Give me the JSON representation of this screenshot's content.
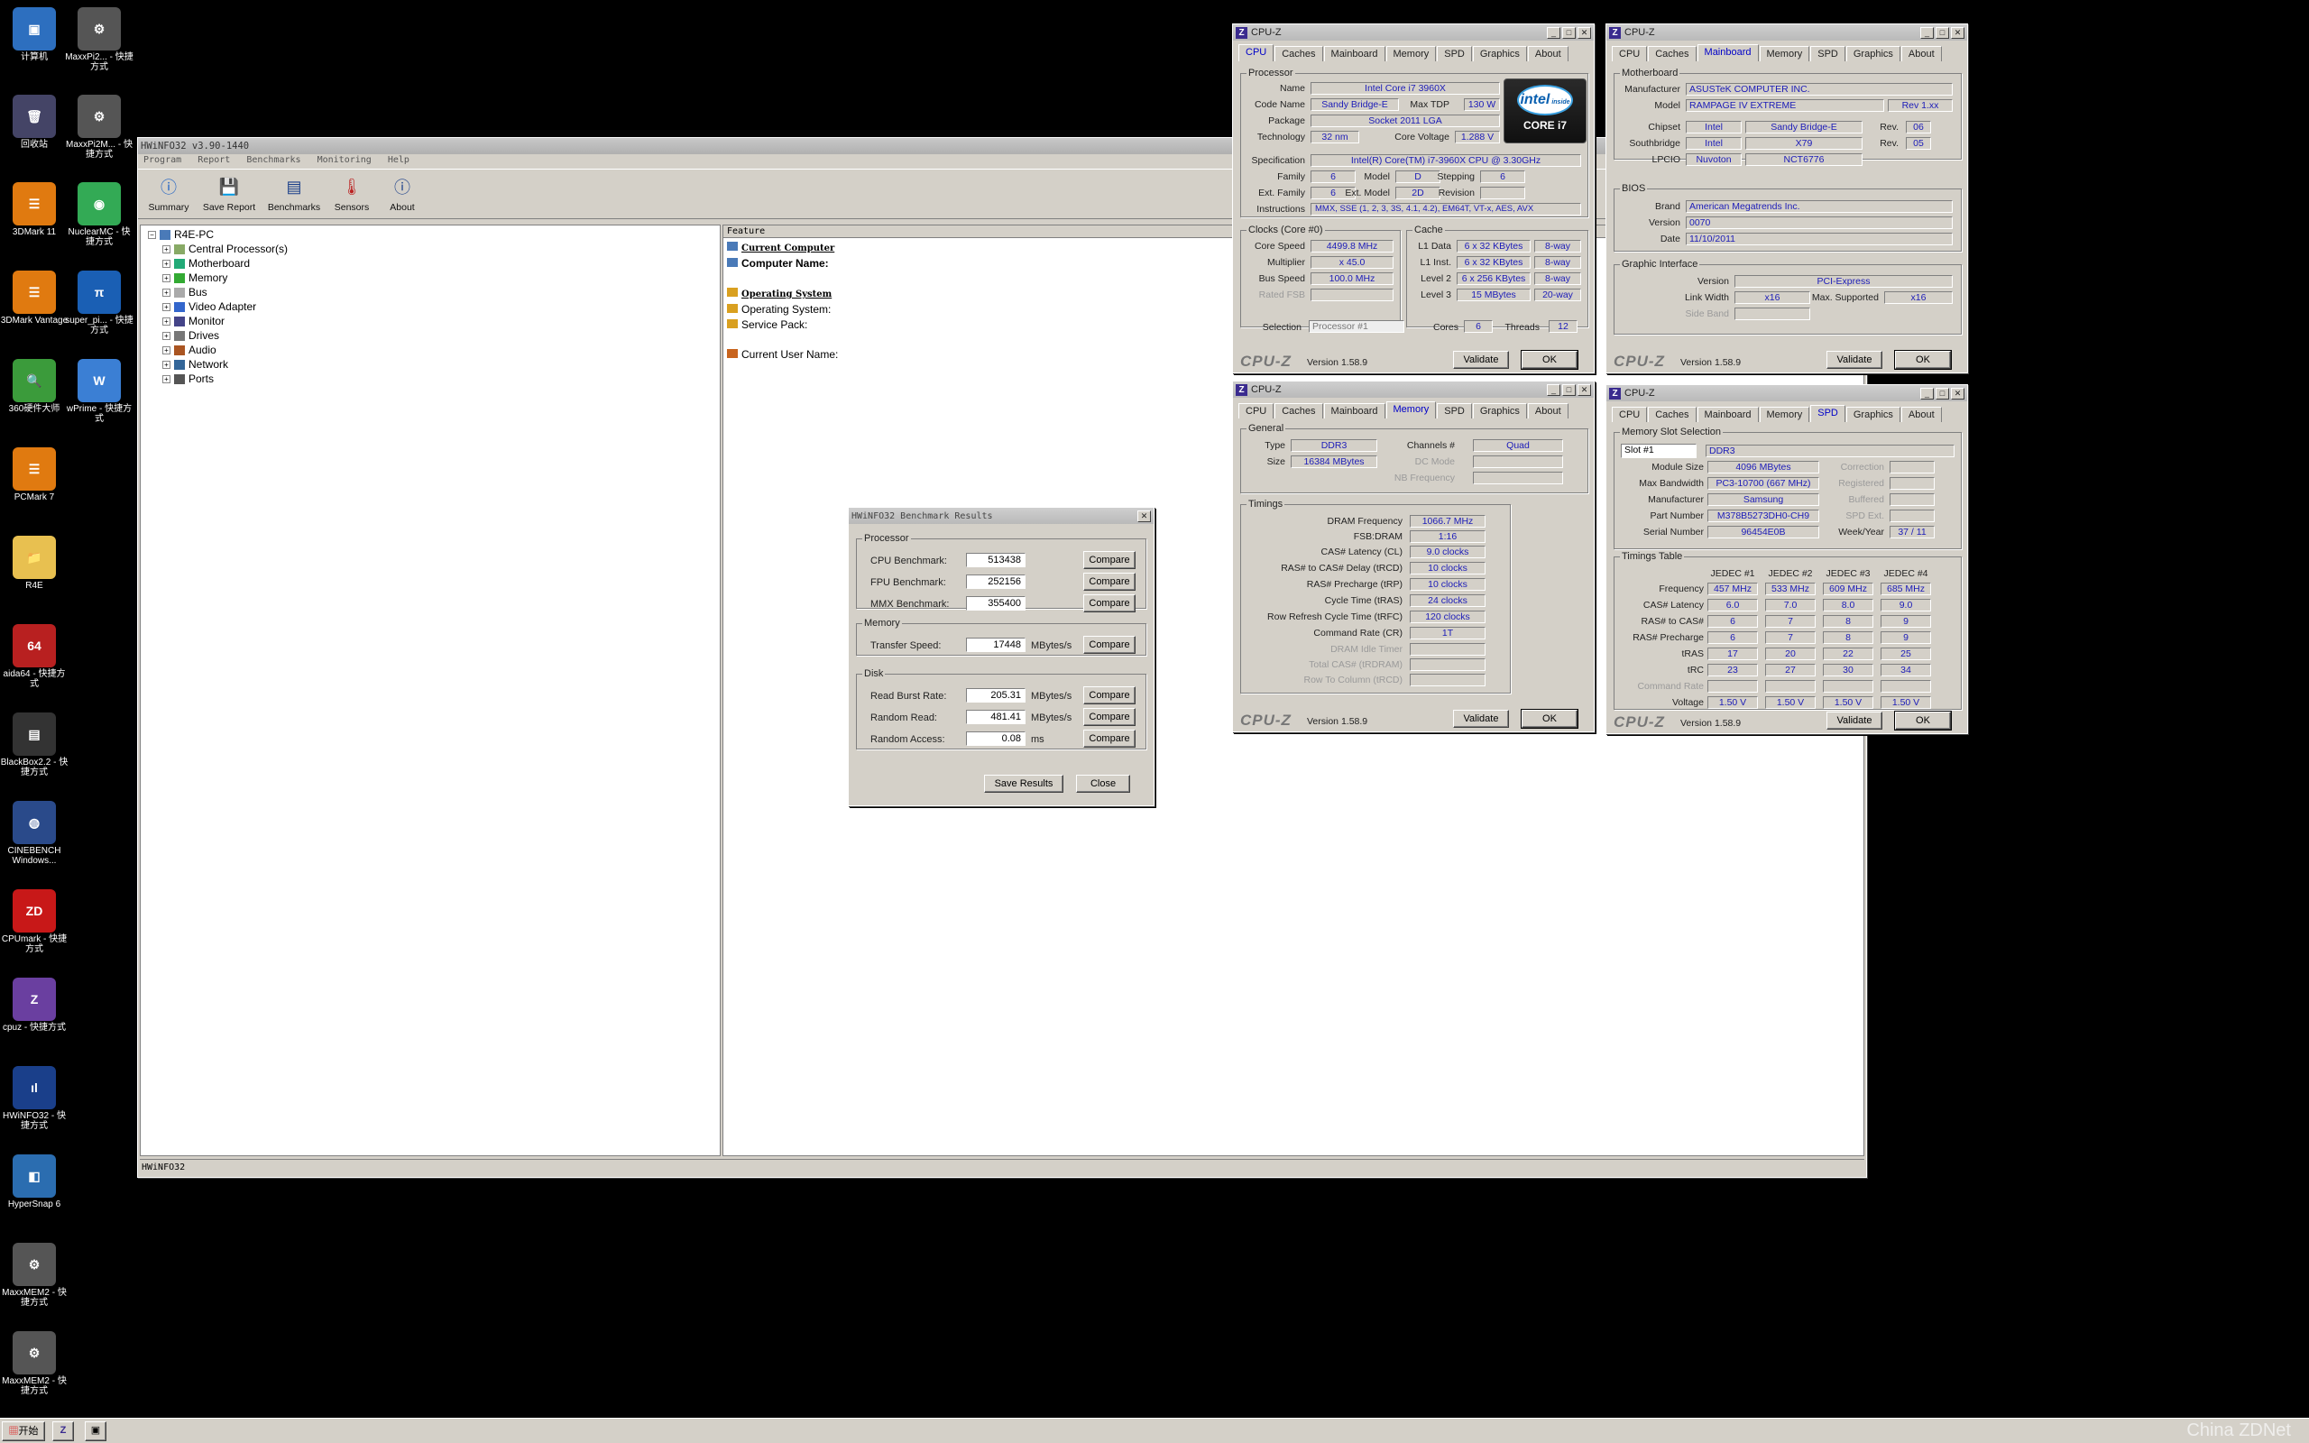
{
  "desktop": {
    "icons": [
      {
        "label": "计算机",
        "color": "#2d6fbf",
        "glyph": "▣"
      },
      {
        "label": "MaxxPi2... - 快捷方式",
        "color": "#555",
        "glyph": "⚙"
      },
      {
        "label": "回收站",
        "color": "#446",
        "glyph": "🗑"
      },
      {
        "label": "MaxxPi2M... - 快捷方式",
        "color": "#555",
        "glyph": "⚙"
      },
      {
        "label": "3DMark 11",
        "color": "#e07a10",
        "glyph": "☰"
      },
      {
        "label": "NuclearMC - 快捷方式",
        "color": "#3a5",
        "glyph": "◉"
      },
      {
        "label": "3DMark Vantage",
        "color": "#e07a10",
        "glyph": "☰"
      },
      {
        "label": "super_pi... - 快捷方式",
        "color": "#1a5fb4",
        "glyph": "π"
      },
      {
        "label": "360硬件大师",
        "color": "#3b9b3b",
        "glyph": "🔍"
      },
      {
        "label": "wPrime - 快捷方式",
        "color": "#3b7fd4",
        "glyph": "W"
      },
      {
        "label": "PCMark 7",
        "color": "#e07a10",
        "glyph": "☰"
      },
      {
        "label": "R4E",
        "color": "#e8c050",
        "glyph": "📁"
      },
      {
        "label": "aida64 - 快捷方式",
        "color": "#b82020",
        "glyph": "64"
      },
      {
        "label": "BlackBox2.2 - 快捷方式",
        "color": "#333",
        "glyph": "▤"
      },
      {
        "label": "CINEBENCH Windows...",
        "color": "#2a4a8a",
        "glyph": "◍"
      },
      {
        "label": "CPUmark - 快捷方式",
        "color": "#c81818",
        "glyph": "ZD"
      },
      {
        "label": "cpuz - 快捷方式",
        "color": "#6a3fa0",
        "glyph": "Z"
      },
      {
        "label": "HWiNFO32 - 快捷方式",
        "color": "#1a3f8a",
        "glyph": "ıl"
      },
      {
        "label": "HyperSnap 6",
        "color": "#2b6db0",
        "glyph": "◧"
      },
      {
        "label": "MaxxMEM2 - 快捷方式",
        "color": "#555",
        "glyph": "⚙"
      },
      {
        "label": "MaxxMEM2 - 快捷方式",
        "color": "#555",
        "glyph": "⚙"
      }
    ]
  },
  "hwinfo": {
    "title": "HWiNFO32 v3.90-1440",
    "menu": [
      "Program",
      "Report",
      "Benchmarks",
      "Monitoring",
      "Help"
    ],
    "toolbar": [
      "Summary",
      "Save Report",
      "Benchmarks",
      "Sensors",
      "About"
    ],
    "tree_root": "R4E-PC",
    "tree": [
      "Central Processor(s)",
      "Motherboard",
      "Memory",
      "Bus",
      "Video Adapter",
      "Monitor",
      "Drives",
      "Audio",
      "Network",
      "Ports"
    ],
    "feature_header": "Feature",
    "current_computer": "Current Computer",
    "computer_name": "Computer Name:",
    "operating_system_hdr": "Operating System",
    "operating_system": "Operating System:",
    "service_pack": "Service Pack:",
    "current_user": "Current User Name:",
    "status": "HWiNFO32"
  },
  "bench": {
    "title": "HWiNFO32 Benchmark Results",
    "processor_group": "Processor",
    "cpu_label": "CPU Benchmark:",
    "cpu": "513438",
    "fpu_label": "FPU Benchmark:",
    "fpu": "252156",
    "mmx_label": "MMX Benchmark:",
    "mmx": "355400",
    "memory_group": "Memory",
    "transfer_label": "Transfer Speed:",
    "transfer": "17448",
    "transfer_unit": "MBytes/s",
    "disk_group": "Disk",
    "burst_label": "Read Burst Rate:",
    "burst": "205.31",
    "burst_unit": "MBytes/s",
    "random_read_label": "Random Read:",
    "random_read": "481.41",
    "random_read_unit": "MBytes/s",
    "random_access_label": "Random Access:",
    "random_access": "0.08",
    "random_access_unit": "ms",
    "compare": "Compare",
    "save": "Save Results",
    "close": "Close"
  },
  "cpuz_common": {
    "title": "CPU-Z",
    "tabs": [
      "CPU",
      "Caches",
      "Mainboard",
      "Memory",
      "SPD",
      "Graphics",
      "About"
    ],
    "brand": "CPU-Z",
    "version": "Version 1.58.9",
    "validate": "Validate",
    "ok": "OK"
  },
  "cpu": {
    "processor": "Processor",
    "name": "Intel Core i7 3960X",
    "code_name": "Sandy Bridge-E",
    "max_tdp": "130 W",
    "package": "Socket 2011 LGA",
    "technology": "32 nm",
    "core_voltage": "1.288 V",
    "specification": "Intel(R) Core(TM) i7-3960X CPU @ 3.30GHz",
    "family": "6",
    "model": "D",
    "stepping": "6",
    "ext_family": "6",
    "ext_model": "2D",
    "revision": "",
    "instructions": "MMX, SSE (1, 2, 3, 3S, 4.1, 4.2), EM64T, VT-x, AES, AVX",
    "clocks": "Clocks (Core #0)",
    "core_speed": "4499.8 MHz",
    "multiplier": "x 45.0",
    "bus_speed": "100.0 MHz",
    "rated_fsb": "",
    "cache": "Cache",
    "l1d": "6 x 32 KBytes",
    "l1d_way": "8-way",
    "l1i": "6 x 32 KBytes",
    "l1i_way": "8-way",
    "l2": "6 x 256 KBytes",
    "l2_way": "8-way",
    "l3": "15 MBytes",
    "l3_way": "20-way",
    "selection": "Processor #1",
    "cores": "6",
    "threads": "12",
    "logo_top": "intel",
    "logo_inside": "inside",
    "logo_bottom": "CORE i7",
    "labels": {
      "name": "Name",
      "code_name": "Code Name",
      "max_tdp": "Max TDP",
      "package": "Package",
      "technology": "Technology",
      "core_voltage": "Core Voltage",
      "specification": "Specification",
      "family": "Family",
      "model": "Model",
      "stepping": "Stepping",
      "ext_family": "Ext. Family",
      "ext_model": "Ext. Model",
      "revision": "Revision",
      "instructions": "Instructions",
      "core_speed": "Core Speed",
      "multiplier": "Multiplier",
      "bus_speed": "Bus Speed",
      "rated_fsb": "Rated FSB",
      "l1d": "L1 Data",
      "l1i": "L1 Inst.",
      "l2": "Level 2",
      "l3": "Level 3",
      "selection": "Selection",
      "cores": "Cores",
      "threads": "Threads"
    }
  },
  "mainboard": {
    "motherboard": "Motherboard",
    "manufacturer": "ASUSTeK COMPUTER INC.",
    "model": "RAMPAGE IV EXTREME",
    "model_rev": "Rev 1.xx",
    "chipset": "Intel",
    "chipset_name": "Sandy Bridge-E",
    "chipset_rev": "06",
    "southbridge": "Intel",
    "southbridge_name": "X79",
    "southbridge_rev": "05",
    "lpcio": "Nuvoton",
    "lpcio_name": "NCT6776",
    "bios": "BIOS",
    "brand": "American Megatrends Inc.",
    "version": "0070",
    "date": "11/10/2011",
    "graphic_interface": "Graphic Interface",
    "gi_version": "PCI-Express",
    "link_width": "x16",
    "max_supported": "x16",
    "labels": {
      "manufacturer": "Manufacturer",
      "model": "Model",
      "chipset": "Chipset",
      "southbridge": "Southbridge",
      "lpcio": "LPCIO",
      "rev": "Rev.",
      "brand": "Brand",
      "version": "Version",
      "date": "Date",
      "link_width": "Link Width",
      "max_supported": "Max. Supported",
      "side_band": "Side Band"
    }
  },
  "memory": {
    "general": "General",
    "type": "DDR3",
    "size": "16384 MBytes",
    "channels": "Quad",
    "dc_mode": "",
    "nb_frequency": "",
    "timings": "Timings",
    "dram_frequency": "1066.7 MHz",
    "fsb_dram": "1:16",
    "cas": "9.0 clocks",
    "rcd": "10 clocks",
    "rp": "10 clocks",
    "ras": "24 clocks",
    "rfc": "120 clocks",
    "cr": "1T",
    "labels": {
      "type": "Type",
      "size": "Size",
      "channels": "Channels #",
      "dc_mode": "DC Mode",
      "nb_frequency": "NB Frequency",
      "dram_frequency": "DRAM Frequency",
      "fsb_dram": "FSB:DRAM",
      "cas": "CAS# Latency (CL)",
      "rcd": "RAS# to CAS# Delay (tRCD)",
      "rp": "RAS# Precharge (tRP)",
      "ras": "Cycle Time (tRAS)",
      "rfc": "Row Refresh Cycle Time (tRFC)",
      "cr": "Command Rate (CR)",
      "idle": "DRAM Idle Timer",
      "rdram": "Total CAS# (tRDRAM)",
      "trcd": "Row To Column (tRCD)"
    }
  },
  "spd": {
    "slot_group": "Memory Slot Selection",
    "slot": "Slot #1",
    "type": "DDR3",
    "module_size": "4096 MBytes",
    "max_bandwidth": "PC3-10700 (667 MHz)",
    "manufacturer": "Samsung",
    "part_number": "M378B5273DH0-CH9",
    "serial_number": "96454E0B",
    "week_year": "37 / 11",
    "labels": {
      "module_size": "Module Size",
      "max_bandwidth": "Max Bandwidth",
      "manufacturer": "Manufacturer",
      "part_number": "Part Number",
      "serial_number": "Serial Number",
      "correction": "Correction",
      "registered": "Registered",
      "buffered": "Buffered",
      "spd_ext": "SPD Ext.",
      "week_year": "Week/Year"
    },
    "timings_group": "Timings Table",
    "jedec_headers": [
      "JEDEC #1",
      "JEDEC #2",
      "JEDEC #3",
      "JEDEC #4"
    ],
    "rows": [
      {
        "label": "Frequency",
        "v": [
          "457 MHz",
          "533 MHz",
          "609 MHz",
          "685 MHz"
        ]
      },
      {
        "label": "CAS# Latency",
        "v": [
          "6.0",
          "7.0",
          "8.0",
          "9.0"
        ]
      },
      {
        "label": "RAS# to CAS#",
        "v": [
          "6",
          "7",
          "8",
          "9"
        ]
      },
      {
        "label": "RAS# Precharge",
        "v": [
          "6",
          "7",
          "8",
          "9"
        ]
      },
      {
        "label": "tRAS",
        "v": [
          "17",
          "20",
          "22",
          "25"
        ]
      },
      {
        "label": "tRC",
        "v": [
          "23",
          "27",
          "30",
          "34"
        ]
      },
      {
        "label": "Command Rate",
        "v": [
          "",
          "",
          "",
          ""
        ]
      },
      {
        "label": "Voltage",
        "v": [
          "1.50 V",
          "1.50 V",
          "1.50 V",
          "1.50 V"
        ]
      }
    ]
  },
  "taskbar": {
    "start": "开始",
    "watermark": "China ZDNet"
  }
}
